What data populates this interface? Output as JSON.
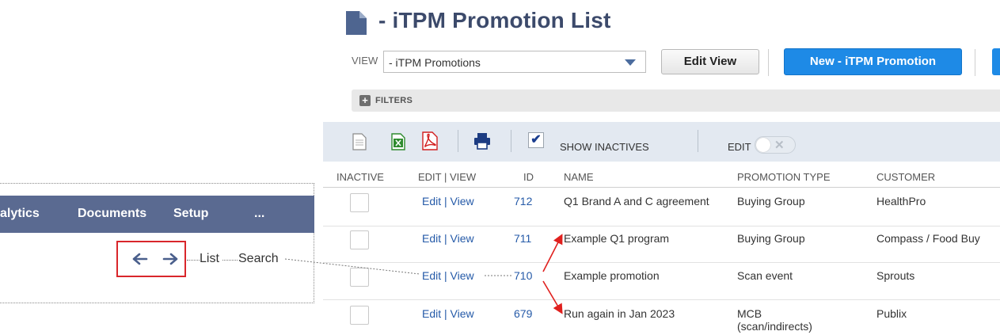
{
  "inset": {
    "nav_items": [
      "alytics",
      "Documents",
      "Setup",
      "..."
    ],
    "back_icon": "arrow-left-icon",
    "forward_icon": "arrow-right-icon",
    "list_label": "List",
    "search_label": "Search",
    "highlight_color": "#d9262b"
  },
  "header": {
    "icon": "document-icon",
    "title": "- iTPM Promotion List"
  },
  "view": {
    "label": "VIEW",
    "selected": "- iTPM Promotions",
    "edit_view_label": "Edit View",
    "new_button_label": "New - iTPM Promotion"
  },
  "filters": {
    "label": "FILTERS"
  },
  "toolbar": {
    "icons": [
      "document-icon",
      "excel-icon",
      "pdf-icon",
      "print-icon"
    ],
    "show_inactives_checked": true,
    "show_inactives_label": "SHOW INACTIVES",
    "edit_label": "EDIT",
    "edit_toggle_on": false
  },
  "table": {
    "columns": [
      "INACTIVE",
      "EDIT | VIEW",
      "ID",
      "NAME",
      "PROMOTION TYPE",
      "CUSTOMER"
    ],
    "rows": [
      {
        "edit": "Edit",
        "sep": " | ",
        "view": "View",
        "id": "712",
        "name": "Q1 Brand A and C agreement",
        "promotion_type": "Buying Group",
        "customer": "HealthPro"
      },
      {
        "edit": "Edit",
        "sep": " | ",
        "view": "View",
        "id": "711",
        "name": "Example Q1 program",
        "promotion_type": "Buying Group",
        "customer": "Compass / Food Buy"
      },
      {
        "edit": "Edit",
        "sep": " | ",
        "view": "View",
        "id": "710",
        "name": "Example promotion",
        "promotion_type": "Scan event",
        "customer": "Sprouts"
      },
      {
        "edit": "Edit",
        "sep": " | ",
        "view": "View",
        "id": "679",
        "name": "Run again in Jan 2023",
        "promotion_type": "MCB (scan/indirects)",
        "customer": "Publix"
      }
    ]
  },
  "colors": {
    "nav_bg": "#5a6a91",
    "title": "#3c4a6b",
    "primary_button": "#1e8ae6",
    "link": "#255aa8",
    "annotation_arrow": "#e0201e"
  }
}
